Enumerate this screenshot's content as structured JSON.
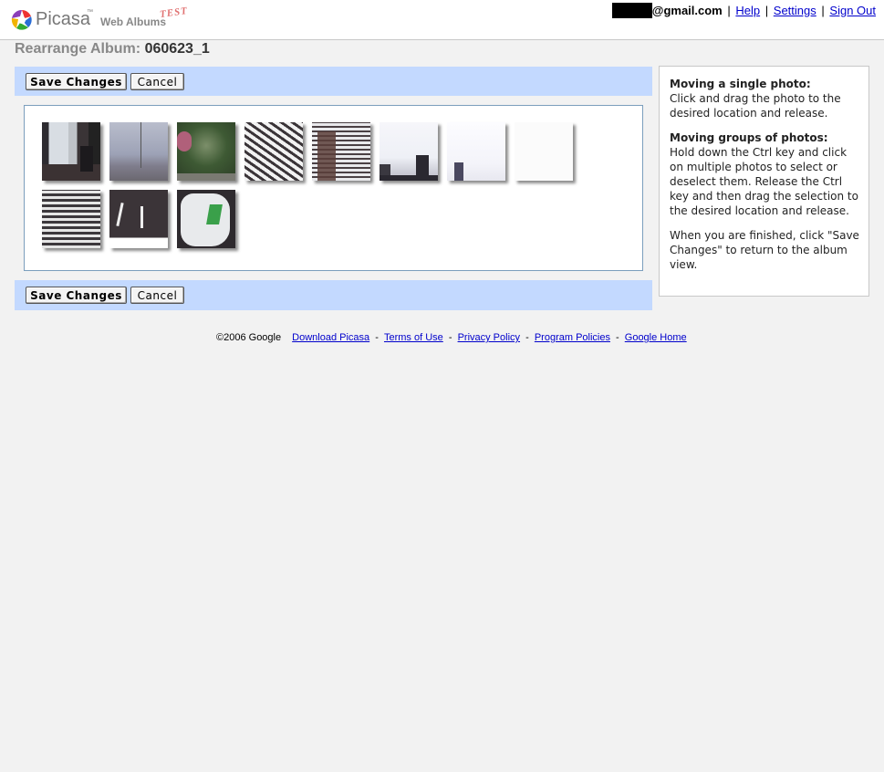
{
  "header": {
    "logo_text": "Picasa",
    "logo_tm": "™",
    "logo_subtitle": "Web Albums",
    "logo_badge": "TEST",
    "email_suffix": "@gmail.com",
    "links": [
      "Help",
      "Settings",
      "Sign Out"
    ],
    "separator": "|"
  },
  "page": {
    "title_prefix": "Rearrange Album:",
    "album_name": "060623_1"
  },
  "toolbar": {
    "save_label": "Save Changes",
    "cancel_label": "Cancel"
  },
  "photos": [
    {
      "description": "office-interior"
    },
    {
      "description": "hazy-sky-pole"
    },
    {
      "description": "green-tree"
    },
    {
      "description": "window-blinds-diagonal"
    },
    {
      "description": "blinds-with-plant"
    },
    {
      "description": "sky-buildings"
    },
    {
      "description": "white-sky-building"
    },
    {
      "description": "blank-white"
    },
    {
      "description": "horizontal-blinds"
    },
    {
      "description": "parking-lines"
    },
    {
      "description": "plastic-bag"
    }
  ],
  "help": {
    "single_heading": "Moving a single photo:",
    "single_text": "Click and drag the photo to the desired location and release.",
    "group_heading": "Moving groups of photos:",
    "group_text": "Hold down the Ctrl key and click on multiple photos to select or deselect them. Release the Ctrl key and then drag the selection to the desired location and release.",
    "finish_text": "When you are finished, click \"Save Changes\" to return to the album view."
  },
  "footer": {
    "copyright": "©2006 Google",
    "links": [
      "Download Picasa",
      "Terms of Use",
      "Privacy Policy",
      "Program Policies",
      "Google Home"
    ],
    "separator": "-"
  },
  "colors": {
    "toolbar_bg": "#c3d9ff",
    "link": "#0000cc",
    "page_bg": "#f2f2f2"
  }
}
